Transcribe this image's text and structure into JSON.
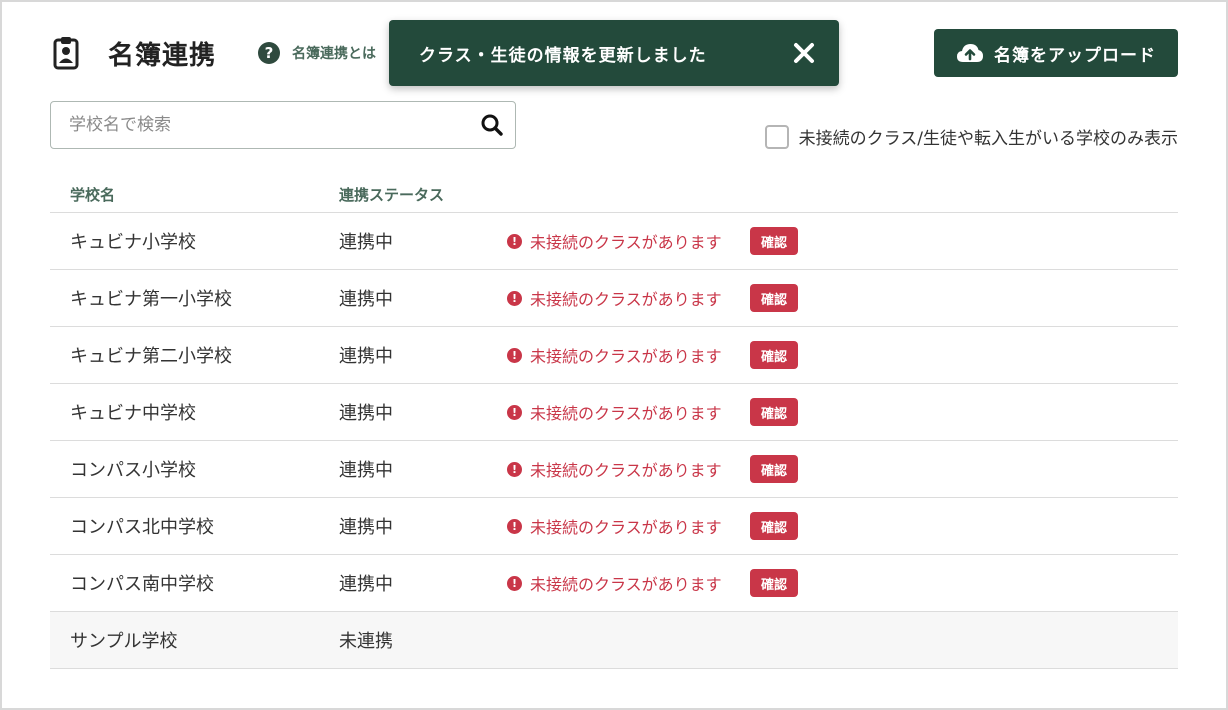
{
  "header": {
    "title": "名簿連携",
    "help_link": "名簿連携とは"
  },
  "toast": {
    "message": "クラス・生徒の情報を更新しました"
  },
  "upload_button": {
    "label": "名簿をアップロード"
  },
  "search": {
    "placeholder": "学校名で検索",
    "value": ""
  },
  "filter": {
    "label": "未接続のクラス/生徒や転入生がいる学校のみ表示",
    "checked": false
  },
  "table": {
    "columns": [
      "学校名",
      "連携ステータス"
    ],
    "rows": [
      {
        "school": "キュビナ小学校",
        "status": "連携中",
        "warning": "未接続のクラスがあります",
        "action": "確認"
      },
      {
        "school": "キュビナ第一小学校",
        "status": "連携中",
        "warning": "未接続のクラスがあります",
        "action": "確認"
      },
      {
        "school": "キュビナ第二小学校",
        "status": "連携中",
        "warning": "未接続のクラスがあります",
        "action": "確認"
      },
      {
        "school": "キュビナ中学校",
        "status": "連携中",
        "warning": "未接続のクラスがあります",
        "action": "確認"
      },
      {
        "school": "コンパス小学校",
        "status": "連携中",
        "warning": "未接続のクラスがあります",
        "action": "確認"
      },
      {
        "school": "コンパス北中学校",
        "status": "連携中",
        "warning": "未接続のクラスがあります",
        "action": "確認"
      },
      {
        "school": "コンパス南中学校",
        "status": "連携中",
        "warning": "未接続のクラスがあります",
        "action": "確認"
      },
      {
        "school": "サンプル学校",
        "status": "未連携"
      }
    ]
  },
  "icons": {
    "title": "clipboard-user-icon",
    "help": "question-circle-icon",
    "toast_close": "close-icon",
    "upload": "cloud-upload-icon",
    "search": "search-icon",
    "warning": "exclamation-circle-icon"
  },
  "colors": {
    "brand": "#234a3b",
    "alert": "#c93648",
    "header_text": "#4a6a5c"
  }
}
